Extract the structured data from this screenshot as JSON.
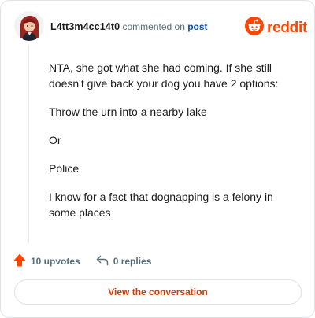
{
  "header": {
    "username": "L4tt3m4cc14t0",
    "action_text": " commented on ",
    "post_link": "post",
    "avatar_icon": "reddit-avatar-icon",
    "logo_word": "reddit",
    "logo_icon": "reddit-snoo-icon",
    "brand_color": "#ff4500"
  },
  "comment": {
    "paragraphs": [
      "NTA, she got what she had coming. If she still doesn't give back your dog you have 2 options:",
      "Throw the urn into a nearby lake",
      "Or",
      "Police",
      "I know for a fact that dognapping is a felony in some places"
    ]
  },
  "footer": {
    "upvotes_label": "10 upvotes",
    "upvote_icon": "upvote-arrow-icon",
    "replies_label": "0 replies",
    "reply_icon": "reply-arrow-icon",
    "view_conversation_label": "View the conversation"
  }
}
